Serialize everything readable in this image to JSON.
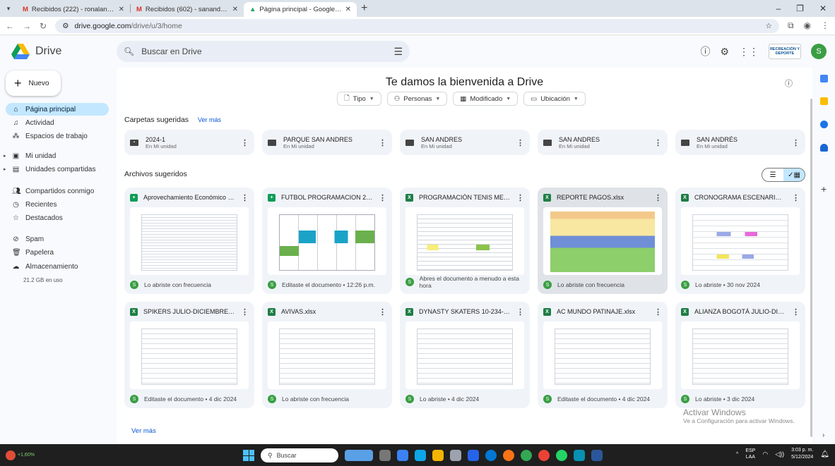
{
  "browser": {
    "tabs": [
      {
        "title": "Recibidos (222) - ronalangulo1",
        "icon": "gmail-icon"
      },
      {
        "title": "Recibidos (602) - sanandres@s",
        "icon": "gmail-icon"
      },
      {
        "title": "Página principal - Google Drive",
        "icon": "drive-icon"
      }
    ],
    "url_host": "drive.google.com",
    "url_path": "/drive/u/3/home"
  },
  "header": {
    "app_name": "Drive",
    "search_placeholder": "Buscar en Drive",
    "org_logo_text": "RECREACIÓN Y DEPORTE",
    "avatar_letter": "S"
  },
  "sidebar": {
    "new_label": "Nuevo",
    "items": [
      {
        "label": "Página principal",
        "icon": "home-icon"
      },
      {
        "label": "Actividad",
        "icon": "bell-icon"
      },
      {
        "label": "Espacios de trabajo",
        "icon": "workspaces-icon"
      },
      {
        "label": "Mi unidad",
        "icon": "my-drive-icon"
      },
      {
        "label": "Unidades compartidas",
        "icon": "shared-drives-icon"
      },
      {
        "label": "Compartidos conmigo",
        "icon": "people-icon"
      },
      {
        "label": "Recientes",
        "icon": "clock-icon"
      },
      {
        "label": "Destacados",
        "icon": "star-icon"
      },
      {
        "label": "Spam",
        "icon": "spam-icon"
      },
      {
        "label": "Papelera",
        "icon": "trash-icon"
      },
      {
        "label": "Almacenamiento",
        "icon": "cloud-icon"
      }
    ],
    "storage": "21.2 GB en uso"
  },
  "main": {
    "welcome": "Te damos la bienvenida a Drive",
    "filters": [
      "Tipo",
      "Personas",
      "Modificado",
      "Ubicación"
    ],
    "suggested_folders_title": "Carpetas sugeridas",
    "see_more": "Ver más",
    "folders": [
      {
        "name": "2024-1",
        "location": "En Mi unidad"
      },
      {
        "name": "PARQUE SAN ANDRES",
        "location": "En Mi unidad"
      },
      {
        "name": "SAN ANDRES",
        "location": "En Mi unidad"
      },
      {
        "name": "SAN ANDRES",
        "location": "En Mi unidad"
      },
      {
        "name": "SAN ANDRÉS",
        "location": "En Mi unidad"
      }
    ],
    "suggested_files_title": "Archivos sugeridos",
    "files": [
      {
        "name": "Aprovechamiento Económico 202...",
        "type": "sheet",
        "reason": "Lo abriste con frecuencia"
      },
      {
        "name": "FUTBOL PROGRAMACION 2024",
        "type": "sheet",
        "reason": "Editaste el documento • 12:26 p.m."
      },
      {
        "name": "PROGRAMACIÓN TENIS MES DE ...",
        "type": "xls",
        "reason": "Abres el documento a menudo a esta hora"
      },
      {
        "name": "REPORTE PAGOS.xlsx",
        "type": "xls",
        "reason": "Lo abriste con frecuencia"
      },
      {
        "name": "CRONOGRAMA ESCENARIOS 202...",
        "type": "xls",
        "reason": "Lo abriste • 30 nov 2024"
      },
      {
        "name": "SPIKERS JULIO-DICIEMBRE 2024...",
        "type": "xls",
        "reason": "Editaste el documento • 4 dic 2024"
      },
      {
        "name": "AVIVAS.xlsx",
        "type": "xls",
        "reason": "Lo abriste con frecuencia"
      },
      {
        "name": "DYNASTY SKATERS 10-234-013-2...",
        "type": "xls",
        "reason": "Lo abriste • 4 dic 2024"
      },
      {
        "name": "AC MUNDO PATINAJE.xlsx",
        "type": "xls",
        "reason": "Editaste el documento • 4 dic 2024"
      },
      {
        "name": "ALIANZA BOGOTÁ JULIO-DICIEM...",
        "type": "xls",
        "reason": "Lo abriste • 3 dic 2024"
      }
    ],
    "see_more_bottom": "Ver más"
  },
  "watermark": {
    "line1": "Activar Windows",
    "line2": "Ve a Configuración para activar Windows."
  },
  "taskbar": {
    "weather": "+1,60%",
    "search": "Buscar",
    "lang_top": "ESP",
    "lang_bottom": "LAA",
    "time": "3:03 p. m.",
    "date": "5/12/2024"
  }
}
